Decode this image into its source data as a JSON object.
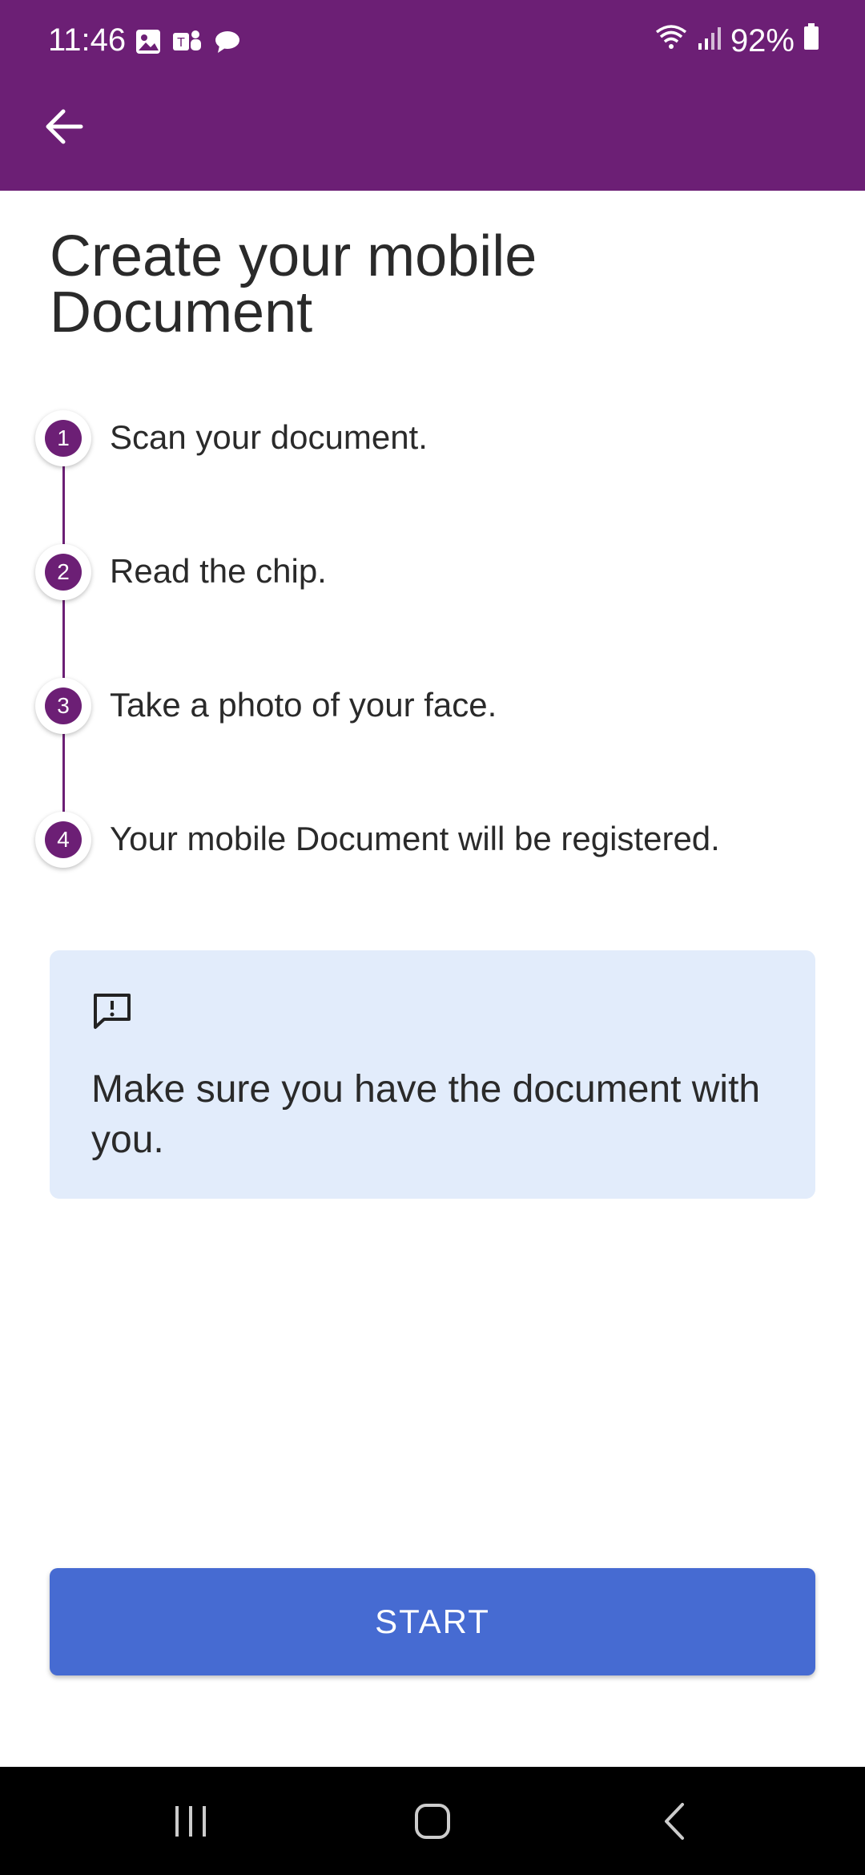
{
  "status_bar": {
    "time": "11:46",
    "battery": "92%",
    "icons_left": [
      "image-icon",
      "teams-icon",
      "chat-bubble-icon"
    ],
    "icons_right": [
      "wifi-icon",
      "signal-icon",
      "battery-icon"
    ]
  },
  "header": {
    "back_icon": "arrow-left-icon",
    "color": "#6c1f75"
  },
  "main": {
    "title": "Create your mobile Document",
    "steps": [
      {
        "number": "1",
        "label": "Scan your document."
      },
      {
        "number": "2",
        "label": "Read the chip."
      },
      {
        "number": "3",
        "label": "Take a photo of your face."
      },
      {
        "number": "4",
        "label": "Your mobile Document will be registered."
      }
    ],
    "info": {
      "icon": "feedback-alert-icon",
      "text": "Make sure you have the document with you."
    },
    "start_button": "START"
  },
  "colors": {
    "accent": "#6c1f75",
    "button": "#466bd2",
    "info_bg": "#e2ecfb"
  },
  "nav_bar": {
    "items": [
      "recent-apps-icon",
      "home-icon",
      "back-icon"
    ]
  }
}
